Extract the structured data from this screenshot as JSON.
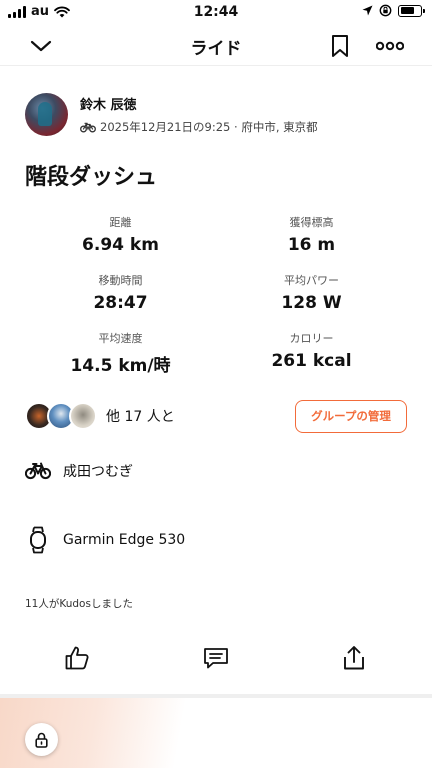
{
  "status_bar": {
    "carrier": "au",
    "time": "12:44"
  },
  "nav": {
    "title": "ライド"
  },
  "profile": {
    "name": "鈴木 辰徳",
    "meta": "2025年12月21日の9:25 · 府中市, 東京都"
  },
  "activity": {
    "title": "階段ダッシュ"
  },
  "stats": [
    {
      "label": "距離",
      "value": "6.94 km"
    },
    {
      "label": "獲得標高",
      "value": "16 m"
    },
    {
      "label": "移動時間",
      "value": "28:47"
    },
    {
      "label": "平均パワー",
      "value": "128 W"
    },
    {
      "label": "平均速度",
      "value": "14.5 km/時"
    },
    {
      "label": "カロリー",
      "value": "261 kcal"
    }
  ],
  "group": {
    "text": "他 17 人と",
    "button_label": "グループの管理"
  },
  "bike": {
    "name": "成田つむぎ"
  },
  "device": {
    "name": "Garmin Edge 530"
  },
  "kudos": {
    "text": "11人がKudosしました"
  },
  "icons": {
    "nav": [
      "chevron-down-icon",
      "bookmark-icon",
      "more-icon"
    ],
    "actions": [
      "thumbs-up-icon",
      "comment-icon",
      "share-icon"
    ],
    "rows": [
      "bike-icon",
      "watch-icon",
      "lock-icon"
    ]
  },
  "colors": {
    "accent": "#f26b3a"
  }
}
